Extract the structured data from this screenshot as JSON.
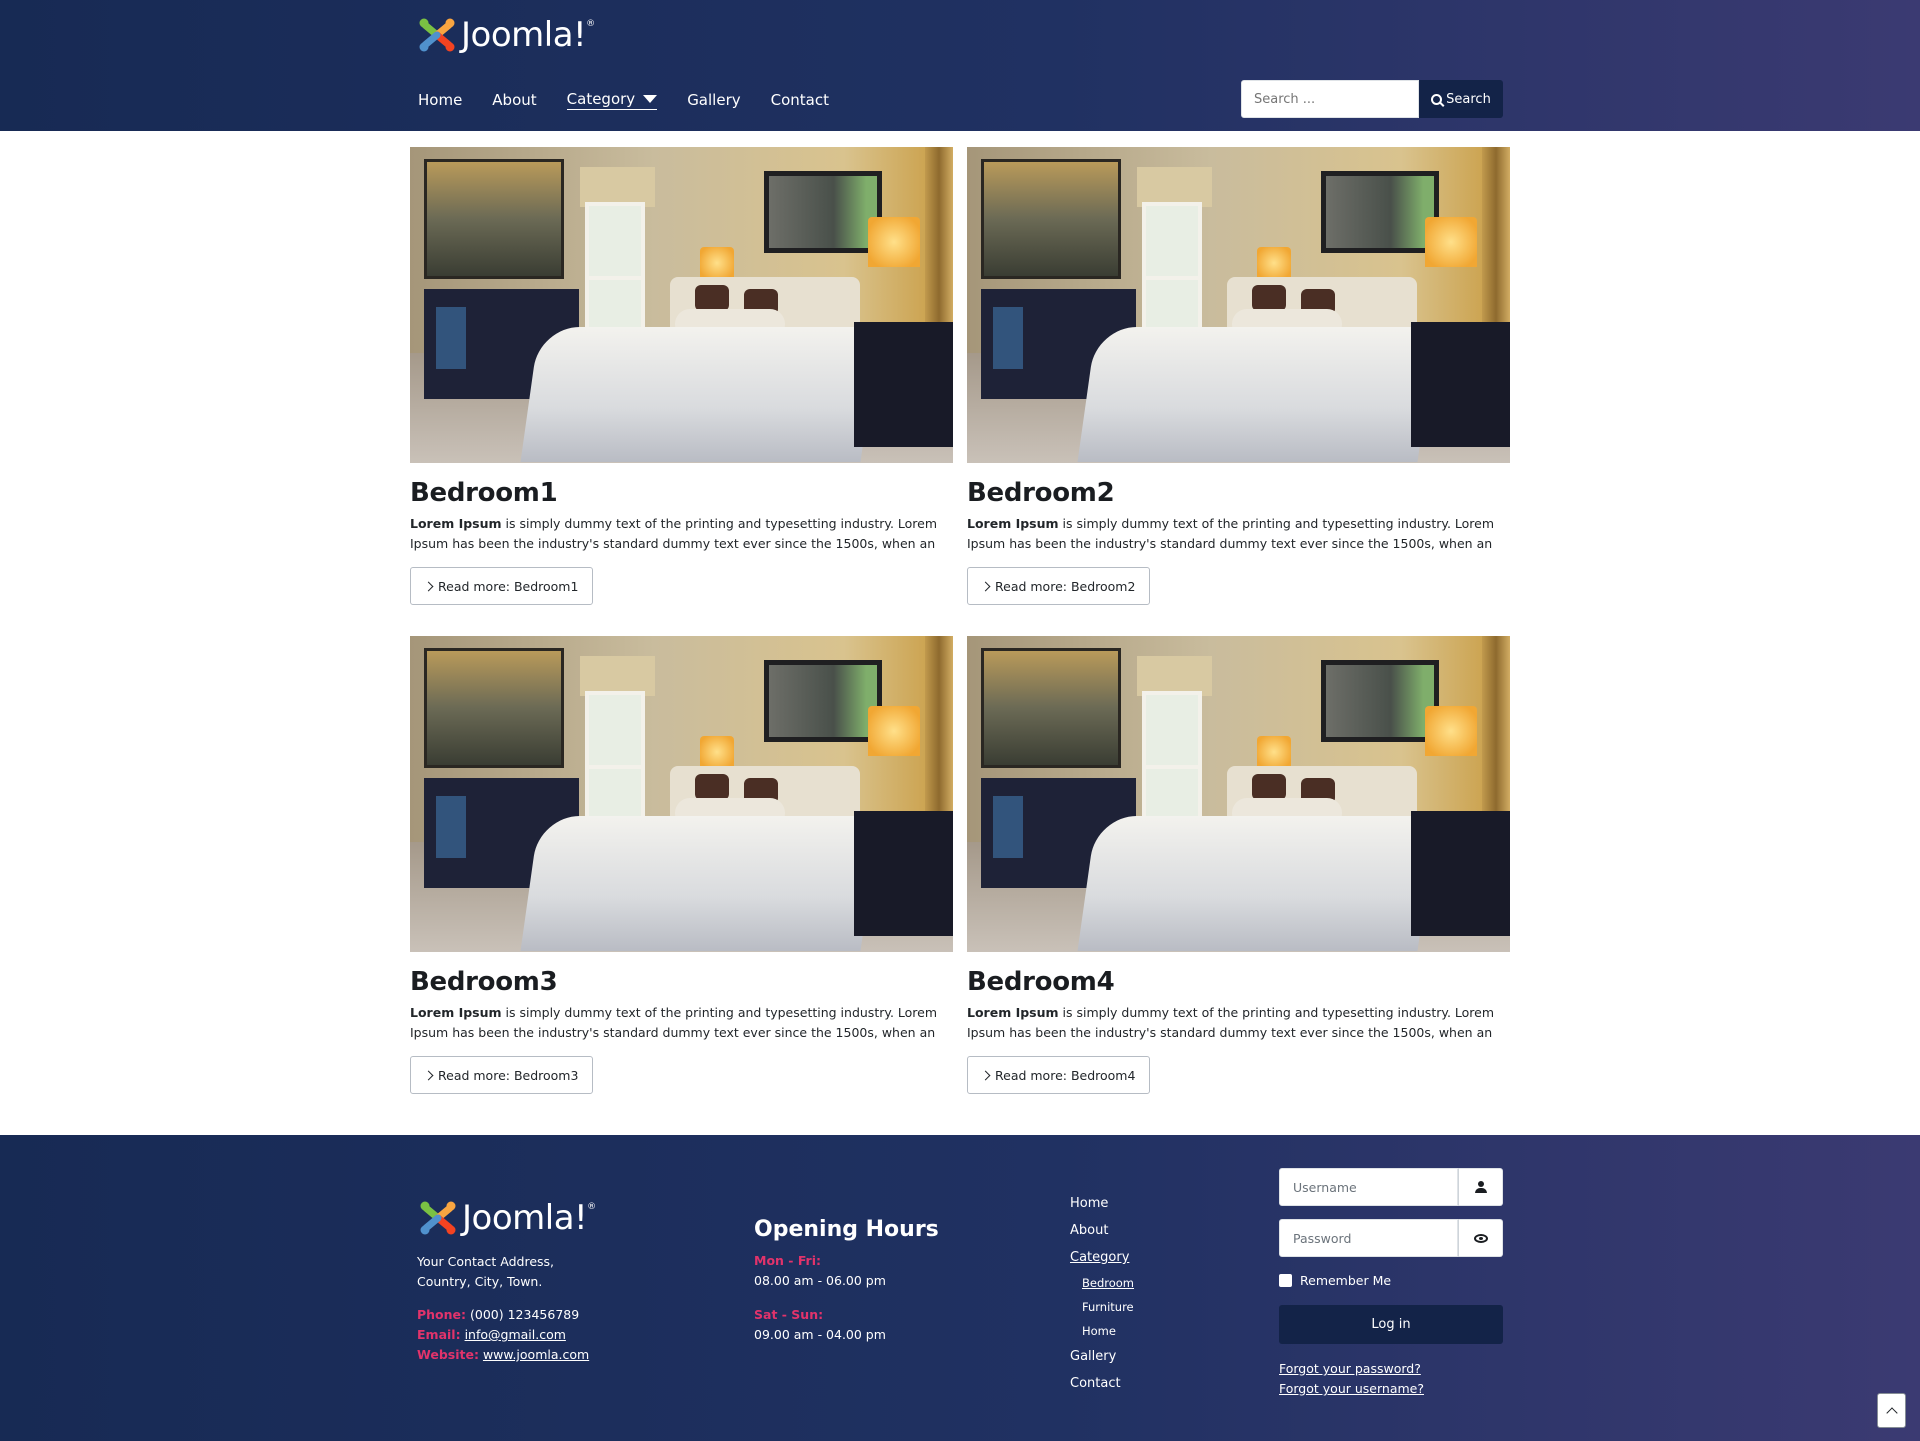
{
  "brand": {
    "name": "Joomla!",
    "mark": "®"
  },
  "nav": {
    "items": [
      "Home",
      "About",
      "Category",
      "Gallery",
      "Contact"
    ]
  },
  "search": {
    "placeholder": "Search ...",
    "button_label": "Search"
  },
  "articles": [
    {
      "title": "Bedroom1",
      "lead_bold": "Lorem Ipsum",
      "body": " is simply dummy text of the printing and typesetting industry. Lorem Ipsum has been the industry's standard dummy text ever since the 1500s, when an",
      "readmore": "Read more: Bedroom1"
    },
    {
      "title": "Bedroom2",
      "lead_bold": "Lorem Ipsum",
      "body": " is simply dummy text of the printing and typesetting industry. Lorem Ipsum has been the industry's standard dummy text ever since the 1500s, when an",
      "readmore": "Read more: Bedroom2"
    },
    {
      "title": "Bedroom3",
      "lead_bold": "Lorem Ipsum",
      "body": " is simply dummy text of the printing and typesetting industry. Lorem Ipsum has been the industry's standard dummy text ever since the 1500s, when an",
      "readmore": "Read more: Bedroom3"
    },
    {
      "title": "Bedroom4",
      "lead_bold": "Lorem Ipsum",
      "body": " is simply dummy text of the printing and typesetting industry. Lorem Ipsum has been the industry's standard dummy text ever since the 1500s, when an",
      "readmore": "Read more: Bedroom4"
    }
  ],
  "footer": {
    "address_line1": "Your Contact Address,",
    "address_line2": "Country, City, Town.",
    "phone_label": "Phone:",
    "phone": "(000) 123456789",
    "email_label": "Email:",
    "email": "info@gmail.com",
    "website_label": "Website:",
    "website": "www.joomla.com",
    "hours_title": "Opening Hours",
    "weekday_label": "Mon - Fri:",
    "weekday_hours": "08.00 am - 06.00 pm",
    "weekend_label": "Sat - Sun:",
    "weekend_hours": "09.00 am - 04.00 pm",
    "menu": {
      "home": "Home",
      "about": "About",
      "category": "Category",
      "sub_bedroom": "Bedroom",
      "sub_furniture": "Furniture",
      "sub_home": "Home",
      "gallery": "Gallery",
      "contact": "Contact"
    },
    "login": {
      "username_placeholder": "Username",
      "password_placeholder": "Password",
      "remember": "Remember Me",
      "button": "Log in",
      "forgot_password": "Forgot your password?",
      "forgot_username": "Forgot your username?"
    }
  },
  "colors": {
    "header_bg_start": "#172a54",
    "header_bg_end": "#3b3a72",
    "button_dark": "#132348",
    "footer_label_accent": "#e2336b"
  },
  "icons": [
    "joomla-logo-icon",
    "search-icon",
    "chevron-right-icon",
    "user-icon",
    "eye-icon",
    "chevron-up-icon",
    "caret-down-icon"
  ]
}
